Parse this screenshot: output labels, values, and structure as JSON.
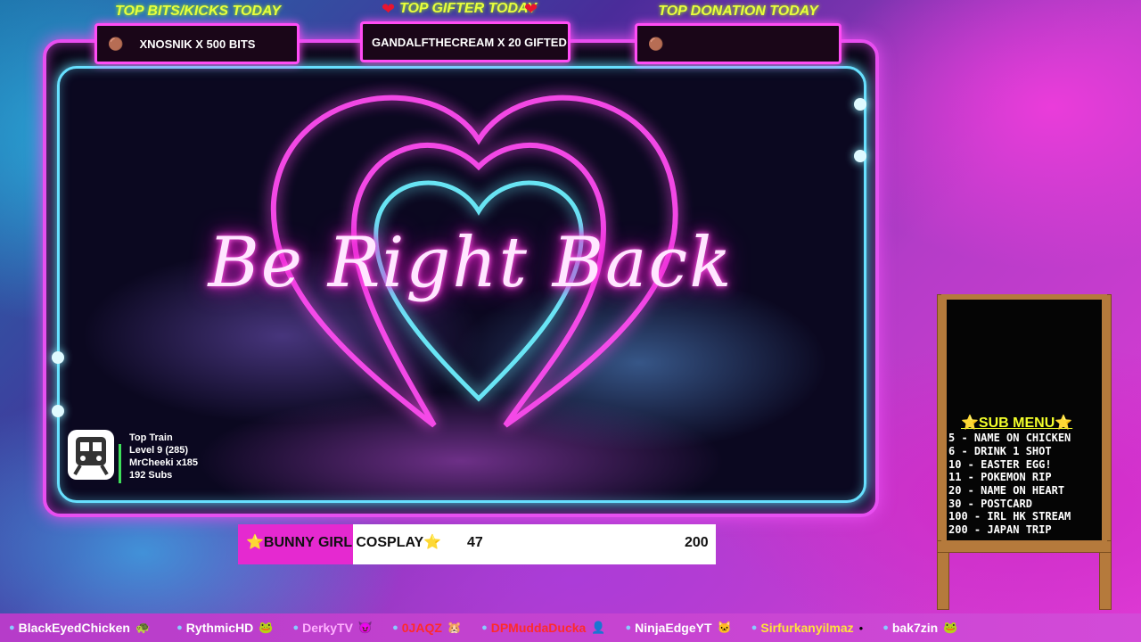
{
  "overlay": {
    "brb_text": "Be Right Back",
    "top_boxes": [
      {
        "label": "TOP BITS/KICKS TODAY",
        "value": "XNOSNIK X 500 BITS",
        "icon": "coin-icon"
      },
      {
        "label": "TOP GIFTER TODAY",
        "value": "GANDALFTHECREAM X 20 GIFTED",
        "icon": "coin-icon"
      },
      {
        "label": "TOP DONATION TODAY",
        "value": "",
        "icon": "coin-icon"
      }
    ],
    "heart_glyph": "❤",
    "coin_glyph": "🟤"
  },
  "train": {
    "title": "Top Train",
    "level": "Level 9  (285)",
    "top_user": "MrCheeki x185",
    "subs": "192 Subs"
  },
  "goal": {
    "label": "⭐BUNNY GIRL COSPLAY⭐",
    "current": "47",
    "max": "200",
    "progress": 0.235
  },
  "sub_menu": {
    "title": "⭐SUB MENU⭐",
    "items": [
      "5 - NAME ON CHICKEN",
      "6 - DRINK 1 SHOT",
      "10 - EASTER EGG!",
      "11 - POKEMON RIP",
      "20 - NAME ON HEART",
      "30 - POSTCARD",
      "100 - IRL HK STREAM",
      "200 - JAPAN TRIP"
    ]
  },
  "ticker": {
    "users": [
      {
        "name": "BlackEyedChicken",
        "color": "#ffffff",
        "emote": "🐢"
      },
      {
        "name": "RythmicHD",
        "color": "#ffffff",
        "emote": "🐸"
      },
      {
        "name": "DerkyTV",
        "color": "#ffb0ff",
        "emote": "😈"
      },
      {
        "name": "0JAQZ",
        "color": "#ff2a2a",
        "emote": "🐹"
      },
      {
        "name": "DPMuddaDucka",
        "color": "#ff2a2a",
        "emote": "👤"
      },
      {
        "name": "NinjaEdgeYT",
        "color": "#ffffff",
        "emote": "🐱"
      },
      {
        "name": "Sirfurkanyilmaz",
        "color": "#ffe23b",
        "emote": "•"
      },
      {
        "name": "bak7zin",
        "color": "#ffffff",
        "emote": "🐸"
      }
    ]
  },
  "colors": {
    "frame_outer": "#e84ef0",
    "frame_inner": "#67e0ff",
    "label_yellow": "#e8ff3c",
    "goal_fill": "#e529d0"
  }
}
